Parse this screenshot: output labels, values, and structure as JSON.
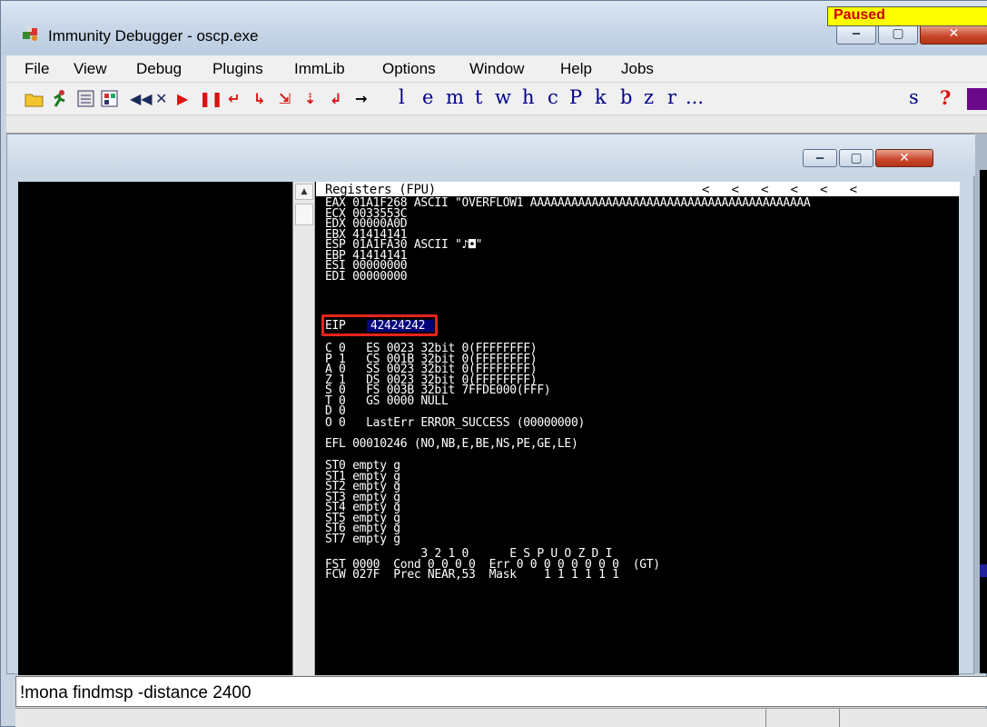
{
  "window": {
    "title": "Immunity Debugger - oscp.exe",
    "minimize": "‒",
    "maximize": "▢",
    "close": "✕"
  },
  "menu": [
    "File",
    "View",
    "Debug",
    "Plugins",
    "ImmLib",
    "Options",
    "Window",
    "Help",
    "Jobs"
  ],
  "toolbar": {
    "nav_icons": [
      "◀◀",
      "✕",
      "▶",
      "❚❚",
      "↵",
      "↳",
      "⇲",
      "⇣",
      "↲",
      "→"
    ],
    "letters": [
      "l",
      "e",
      "m",
      "t",
      "w",
      "h",
      "c",
      "P",
      "k",
      "b",
      "z",
      "r",
      "...",
      "s"
    ],
    "help": "?"
  },
  "registers": {
    "header": "Registers (FPU)",
    "header_arrows": "<   <   <   <   <   <",
    "lines": [
      "EAX 01A1F268 ASCII \"OVERFLOW1 AAAAAAAAAAAAAAAAAAAAAAAAAAAAAAAAAAAAAAAAA",
      "ECX 0033553C",
      "EDX 00000A0D",
      "EBX 41414141",
      "ESP 01A1FA30 ASCII \"♪◘\"",
      "EBP 41414141",
      "ESI 00000000",
      "EDI 00000000"
    ],
    "eip_label": "EIP",
    "eip_value": "42424242",
    "flags": [
      "C 0   ES 0023 32bit 0(FFFFFFFF)",
      "P 1   CS 001B 32bit 0(FFFFFFFF)",
      "A 0   SS 0023 32bit 0(FFFFFFFF)",
      "Z 1   DS 0023 32bit 0(FFFFFFFF)",
      "S 0   FS 003B 32bit 7FFDE000(FFF)",
      "T 0   GS 0000 NULL",
      "D 0",
      "O 0   LastErr ERROR_SUCCESS (00000000)"
    ],
    "efl": "EFL 00010246 (NO,NB,E,BE,NS,PE,GE,LE)",
    "fpu": [
      "ST0 empty g",
      "ST1 empty g",
      "ST2 empty g",
      "ST3 empty g",
      "ST4 empty g",
      "ST5 empty g",
      "ST6 empty g",
      "ST7 empty g"
    ],
    "fpu_status": [
      "              3 2 1 0      E S P U O Z D I",
      "FST 0000  Cond 0 0 0 0  Err 0 0 0 0 0 0 0 0  (GT)",
      "FCW 027F  Prec NEAR,53  Mask    1 1 1 1 1 1"
    ]
  },
  "command": {
    "value": "!mona findmsp -distance 2400"
  },
  "status": {
    "state": "Paused"
  }
}
